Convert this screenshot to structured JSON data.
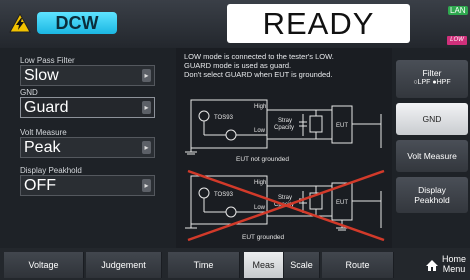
{
  "header": {
    "mode": "DCW",
    "status": "READY",
    "lan_label": "LAN",
    "low_badge": "LOW"
  },
  "left_panel": {
    "fields": [
      {
        "label": "Low Pass Filter",
        "value": "Slow"
      },
      {
        "label": "GND",
        "value": "Guard"
      },
      {
        "label": "Volt Measure",
        "value": "Peak"
      },
      {
        "label": "Display Peakhold",
        "value": "OFF"
      }
    ]
  },
  "info": {
    "lines": [
      "LOW mode is connected to the tester's LOW.",
      "GUARD mode is used as guard.",
      "Don't select GUARD when EUT is grounded."
    ],
    "diagram1": {
      "high": "High",
      "low": "Low",
      "device": "TOS93",
      "stray": "Stray",
      "capacity": "Cpacity",
      "eut": "EUT",
      "caption": "EUT not grounded"
    },
    "diagram2": {
      "high": "High",
      "low": "Low",
      "device": "TOS93",
      "stray": "Stray",
      "capacity": "Cpacity",
      "eut": "EUT",
      "caption": "EUT grounded"
    }
  },
  "right_panel": {
    "filter_title": "Filter",
    "filter_options": [
      "LPF",
      "HPF"
    ],
    "gnd_button": "GND",
    "volt_measure_button": "Volt Measure",
    "display_peakhold_line1": "Display",
    "display_peakhold_line2": "Peakhold"
  },
  "tabs": [
    "Voltage",
    "Judgement",
    "Time",
    "Meas",
    "Scale",
    "Route"
  ],
  "home": {
    "line1": "Home",
    "line2": "Menu"
  },
  "colors": {
    "accent": "#1bb7e3",
    "active_button": "#e6e8ea",
    "cross": "#d23a2a"
  }
}
